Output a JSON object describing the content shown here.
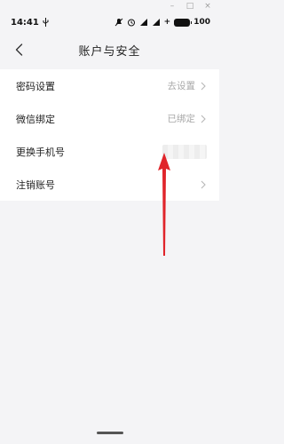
{
  "status_bar": {
    "time": "14:41",
    "battery": "100"
  },
  "window_controls": [
    "–",
    "□",
    "×"
  ],
  "header": {
    "title": "账户与安全"
  },
  "settings": [
    {
      "label": "密码设置",
      "value": "去设置",
      "has_chevron": true
    },
    {
      "label": "微信绑定",
      "value": "已绑定",
      "has_chevron": true
    },
    {
      "label": "更换手机号",
      "value": "",
      "masked": true,
      "has_chevron": false
    },
    {
      "label": "注销账号",
      "value": "",
      "has_chevron": true
    }
  ],
  "colors": {
    "background": "#f4f4f6",
    "annotation_arrow": "#e0242a",
    "secondary_text": "#a8a8a8"
  }
}
